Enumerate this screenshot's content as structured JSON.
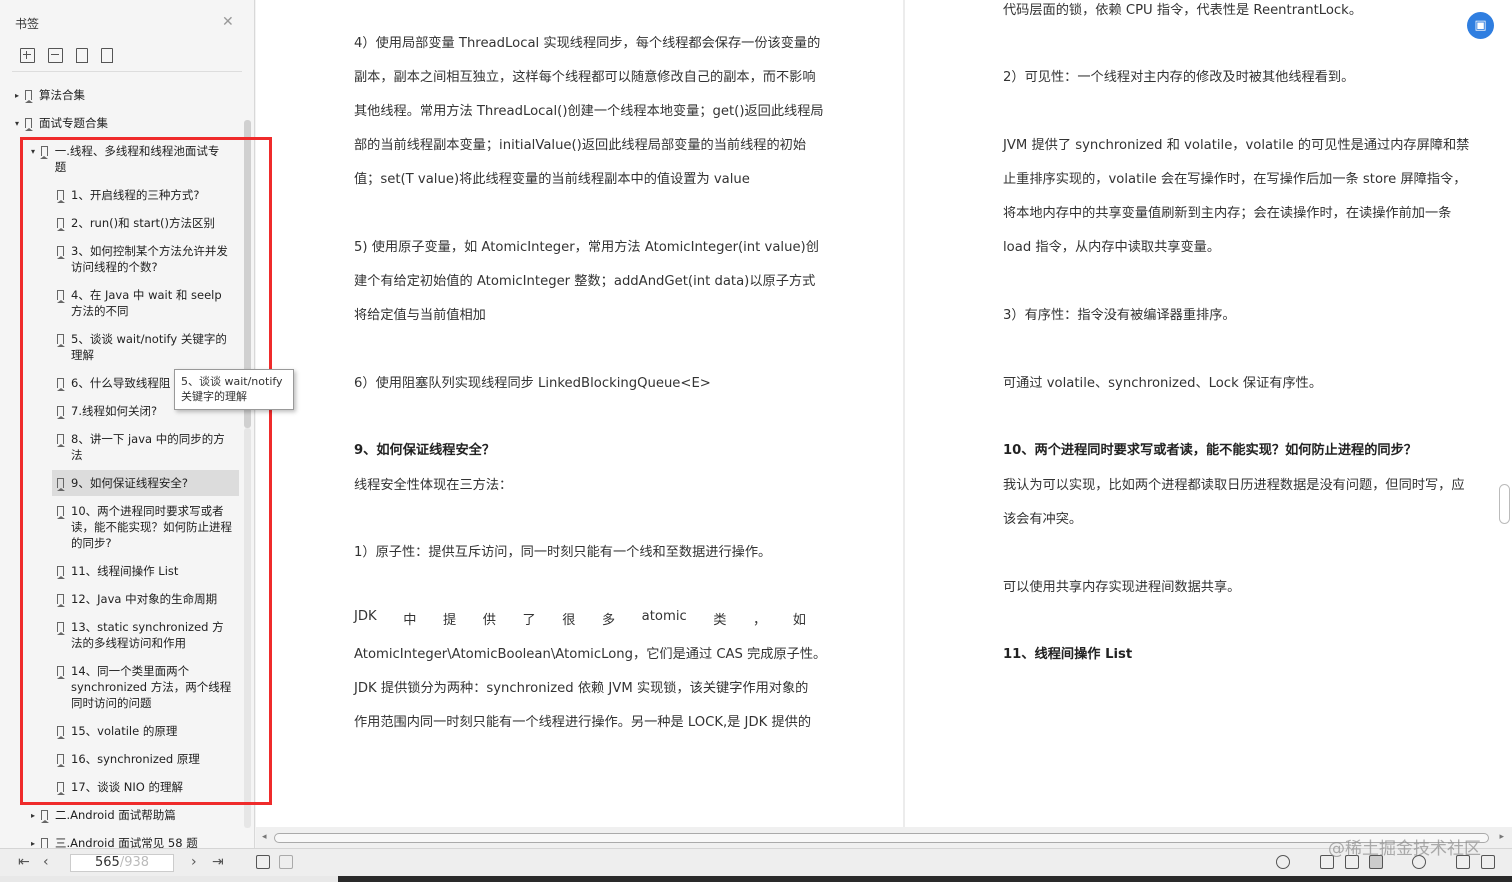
{
  "sidebar": {
    "title": "书签",
    "close_icon": "close-icon",
    "tools": [
      "expand-all-icon",
      "collapse-all-icon",
      "add-bookmark-icon",
      "bookmark-icon"
    ],
    "items": [
      {
        "label": "算法合集",
        "expander": "▸"
      },
      {
        "label": "面试专题合集",
        "expander": "▾"
      },
      {
        "label": "一.线程、多线程和线程池面试专题",
        "expander": "▾"
      },
      {
        "label": "1、开启线程的三种方式?"
      },
      {
        "label": "2、run()和 start()方法区别"
      },
      {
        "label": "3、如何控制某个方法允许并发访问线程的个数?"
      },
      {
        "label": "4、在 Java 中 wait 和 seelp 方法的不同"
      },
      {
        "label": "5、谈谈 wait/notify 关键字的理解"
      },
      {
        "label": "6、什么导致线程阻"
      },
      {
        "label": "7.线程如何关闭?"
      },
      {
        "label": "8、讲一下 java 中的同步的方法"
      },
      {
        "label": "9、如何保证线程安全?"
      },
      {
        "label": "10、两个进程同时要求写或者读，能不能实现？如何防止进程的同步?"
      },
      {
        "label": "11、线程间操作 List"
      },
      {
        "label": "12、Java 中对象的生命周期"
      },
      {
        "label": "13、static synchronized 方法的多线程访问和作用"
      },
      {
        "label": "14、同一个类里面两个 synchronized 方法，两个线程同时访问的问题"
      },
      {
        "label": "15、volatile 的原理"
      },
      {
        "label": "16、synchronized 原理"
      },
      {
        "label": "17、谈谈 NIO 的理解"
      },
      {
        "label": "二.Android 面试帮助篇",
        "expander": "▸"
      },
      {
        "label": "三.Android 面试常见 58 题",
        "expander": "▸"
      }
    ],
    "tooltip": "5、谈谈 wait/notify 关键字的理解"
  },
  "page_left": {
    "lines": [
      "4）使用局部变量 ThreadLocal 实现线程同步，每个线程都会保存一份该变量的",
      "副本，副本之间相互独立，这样每个线程都可以随意修改自己的副本，而不影响",
      "其他线程。常用方法 ThreadLocal()创建一个线程本地变量；get()返回此线程局",
      "部的当前线程副本变量；initialValue()返回此线程局部变量的当前线程的初始",
      "值；set(T value)将此线程变量的当前线程副本中的值设置为 value",
      "5) 使用原子变量，如 AtomicInteger，常用方法 AtomicInteger(int value)创",
      "建个有给定初始值的 AtomicInteger 整数；addAndGet(int data)以原子方式",
      "将给定值与当前值相加",
      "6）使用阻塞队列实现线程同步 LinkedBlockingQueue<E>",
      "9、如何保证线程安全？",
      "线程安全性体现在三方法：",
      "1）原子性：提供互斥访问，同一时刻只能有一个线和至数据进行操作。",
      "AtomicInteger\\AtomicBoolean\\AtomicLong，它们是通过 CAS 完成原子性。",
      "JDK 提供锁分为两种：synchronized 依赖 JVM 实现锁，该关键字作用对象的",
      "作用范围内同一时刻只能有一个线程进行操作。另一种是 LOCK,是 JDK 提供的"
    ],
    "just_line": [
      "JDK",
      "中",
      "提",
      "供",
      "了",
      "很",
      "多",
      "atomic",
      "类",
      "，",
      "如"
    ]
  },
  "page_right": {
    "lines": [
      "代码层面的锁，依赖 CPU 指令，代表性是 ReentrantLock。",
      "2）可见性：一个线程对主内存的修改及时被其他线程看到。",
      "JVM 提供了 synchronized 和 volatile，volatile 的可见性是通过内存屏障和禁",
      "止重排序实现的，volatile 会在写操作时，在写操作后加一条 store 屏障指令，",
      "将本地内存中的共享变量值刷新到主内存；会在读操作时，在读操作前加一条",
      "load 指令，从内存中读取共享变量。",
      "3）有序性：指令没有被编译器重排序。",
      "可通过 volatile、synchronized、Lock 保证有序性。",
      "10、两个进程同时要求写或者读，能不能实现？如何防止进程的同步？",
      "我认为可以实现，比如两个进程都读取日历进程数据是没有问题，但同时写，应",
      "该会有冲突。",
      "可以使用共享内存实现进程间数据共享。",
      "11、线程间操作 List"
    ]
  },
  "bottombar": {
    "current_page": "565",
    "total_pages": "/938",
    "nav": [
      "⇤",
      "‹",
      "›",
      "⇥"
    ]
  },
  "watermark": "@稀土掘金技术社区",
  "colors": {
    "highlight_box": "#ef2b2b",
    "fab": "#2f7ee0"
  }
}
